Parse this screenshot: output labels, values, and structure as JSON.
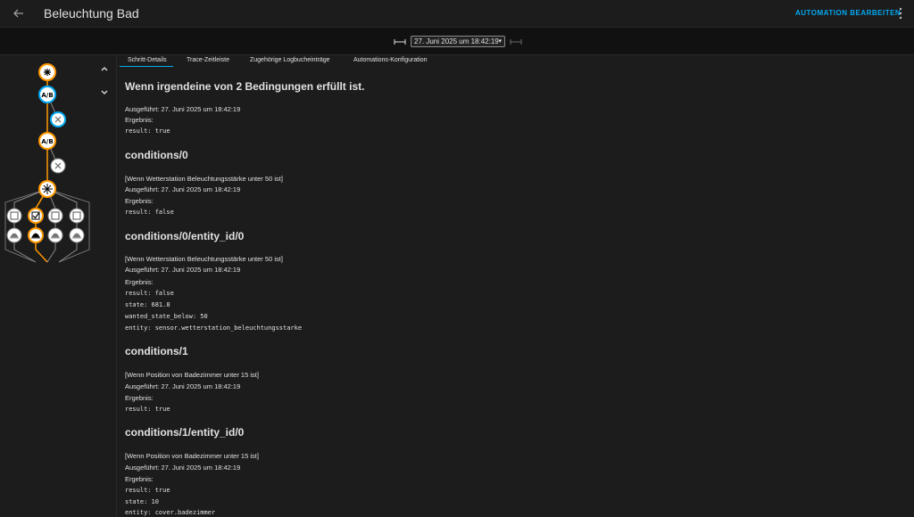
{
  "header": {
    "title": "Beleuchtung Bad",
    "edit_label": "AUTOMATION BEARBEITEN",
    "back_icon": "arrow-left-icon",
    "menu_icon": "dots-vertical-icon"
  },
  "toolbar": {
    "selected_trace": "27. Juni 2025 um 18:42:19"
  },
  "tabs": [
    {
      "label": "Schritt-Details"
    },
    {
      "label": "Trace-Zeitleiste"
    },
    {
      "label": "Zugehörige Logbucheinträge"
    },
    {
      "label": "Automations-Konfiguration"
    }
  ],
  "colors": {
    "accent": "#03a9f4",
    "trace": "#ff9800"
  },
  "details": {
    "heading": "Wenn irgendeine von 2 Bedingungen erfüllt ist.",
    "executed": "Ausgeführt: 27. Juni 2025 um 18:42:19",
    "result_label": "Ergebnis:",
    "result": "result: true",
    "sections": [
      {
        "title": "conditions/0",
        "desc": "[Wenn Wetterstation Beleuchtungsstärke unter 50 ist]",
        "executed": "Ausgeführt: 27. Juni 2025 um 18:42:19",
        "result_label": "Ergebnis:",
        "lines": [
          "result: false"
        ]
      },
      {
        "title": "conditions/0/entity_id/0",
        "desc": "[Wenn Wetterstation Beleuchtungsstärke unter 50 ist]",
        "executed": "Ausgeführt: 27. Juni 2025 um 18:42:19",
        "result_label": "Ergebnis:",
        "lines": [
          "result: false",
          "state: 681.8",
          "wanted_state_below: 50",
          "entity: sensor.wetterstation_beleuchtungsstarke"
        ]
      },
      {
        "title": "conditions/1",
        "desc": "[Wenn Position von Badezimmer unter 15 ist]",
        "executed": "Ausgeführt: 27. Juni 2025 um 18:42:19",
        "result_label": "Ergebnis:",
        "lines": [
          "result: true"
        ]
      },
      {
        "title": "conditions/1/entity_id/0",
        "desc": "[Wenn Position von Badezimmer unter 15 ist]",
        "executed": "Ausgeführt: 27. Juni 2025 um 18:42:19",
        "result_label": "Ergebnis:",
        "lines": [
          "result: true",
          "state: 10",
          "entity: cover.badezimmer"
        ]
      }
    ]
  }
}
